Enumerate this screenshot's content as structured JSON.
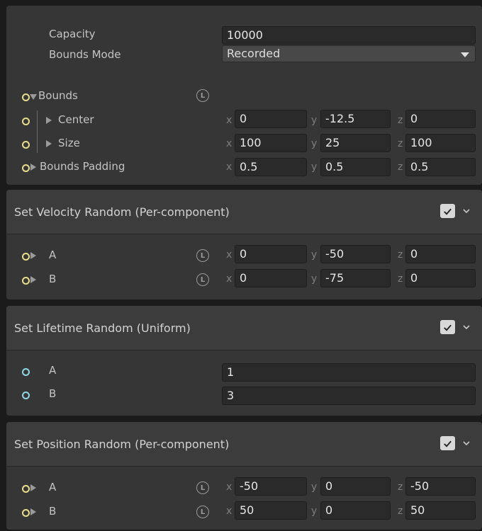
{
  "top": {
    "capacity_label": "Capacity",
    "capacity_value": "10000",
    "bounds_mode_label": "Bounds Mode",
    "bounds_mode_value": "Recorded",
    "bounds_label": "Bounds",
    "lock_glyph": "L",
    "rows": [
      {
        "label": "Center",
        "x": "0",
        "y": "-12.5",
        "z": "0"
      },
      {
        "label": "Size",
        "x": "100",
        "y": "25",
        "z": "100"
      },
      {
        "label": "Bounds Padding",
        "x": "0.5",
        "y": "0.5",
        "z": "0.5"
      }
    ]
  },
  "axis_labels": {
    "x": "x",
    "y": "y",
    "z": "z"
  },
  "velocity": {
    "title": "Set Velocity Random (Per-component)",
    "rows": [
      {
        "label": "A",
        "x": "0",
        "y": "-50",
        "z": "0"
      },
      {
        "label": "B",
        "x": "0",
        "y": "-75",
        "z": "0"
      }
    ]
  },
  "lifetime": {
    "title": "Set Lifetime Random (Uniform)",
    "rows": [
      {
        "label": "A",
        "value": "1"
      },
      {
        "label": "B",
        "value": "3"
      }
    ]
  },
  "position": {
    "title": "Set Position Random (Per-component)",
    "rows": [
      {
        "label": "A",
        "x": "-50",
        "y": "0",
        "z": "-50"
      },
      {
        "label": "B",
        "x": "50",
        "y": "0",
        "z": "50"
      }
    ]
  },
  "colors": {
    "background": "#1b1b1b",
    "panel": "#363636",
    "header": "#3c3c3c",
    "field": "#2a2a2a",
    "port_yellow": "#e8dd8c",
    "port_cyan": "#8fd6e6"
  }
}
